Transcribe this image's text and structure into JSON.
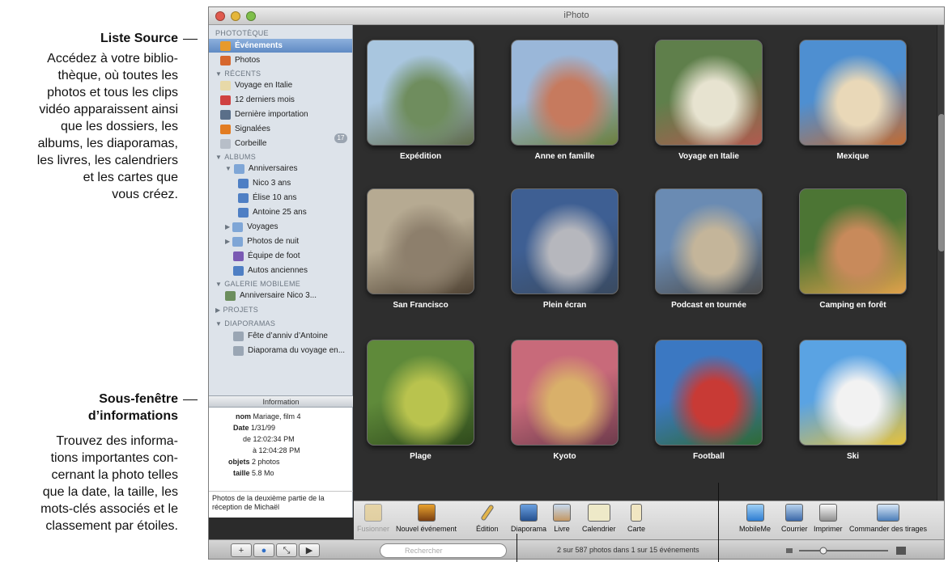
{
  "window": {
    "title": "iPhoto"
  },
  "callouts": {
    "source": {
      "title": "Liste Source",
      "lines": [
        "Accédez à votre biblio-",
        "thèque, où toutes les",
        "photos et tous les clips",
        "vidéo apparaissent ainsi",
        "que les dossiers, les",
        "albums, les diaporamas,",
        "les livres, les calendriers",
        "et les cartes que",
        "vous créez."
      ]
    },
    "info": {
      "title_lines": [
        "Sous-fenêtre",
        "d’informations"
      ],
      "lines": [
        "Trouvez des informa-",
        "tions importantes con-",
        "cernant la photo telles",
        "que la date, la taille, les",
        "mots-clés associés et le",
        "classement par étoiles."
      ]
    }
  },
  "sidebar": {
    "sections": {
      "library": "PHOTOTÈQUE",
      "recents": "RÉCENTS",
      "albums": "ALBUMS",
      "gallery": "GALERIE MOBILEME",
      "projects": "PROJETS",
      "slideshows": "DIAPORAMAS"
    },
    "items": {
      "events": "Événements",
      "photos": "Photos",
      "italy": "Voyage en Italie",
      "months": "12 derniers mois",
      "import": "Dernière importation",
      "flagged": "Signalées",
      "trash": "Corbeille",
      "birthdays": "Anniversaires",
      "nico": "Nico 3 ans",
      "elise": "Élise 10 ans",
      "antoine": "Antoine 25 ans",
      "voyages": "Voyages",
      "night": "Photos de nuit",
      "foot": "Équipe de foot",
      "autos": "Autos anciennes",
      "gallery_item": "Anniversaire Nico 3...",
      "fete": "Fête d’anniv d’Antoine",
      "diapo": "Diaporama du voyage en..."
    },
    "flagged_count": "17"
  },
  "info_pane": {
    "header": "Information",
    "name_label": "nom",
    "name_value": "Mariage, film 4",
    "date_label": "Date",
    "date_value": "1/31/99",
    "from_label": "de",
    "from_value": "12:02:34 PM",
    "to_label": "à",
    "to_value": "12:04:28 PM",
    "items_label": "objets",
    "items_value": "2 photos",
    "size_label": "taille",
    "size_value": "5.8 Mo",
    "comment": "Photos de la deuxième partie de la réception de Michaël"
  },
  "events": [
    {
      "label": "Expédition",
      "colors": [
        "#a9c6df",
        "#6f8d5e",
        "#5e6a49"
      ]
    },
    {
      "label": "Anne en famille",
      "colors": [
        "#9ab7d9",
        "#c67a5e",
        "#6b7f3d"
      ]
    },
    {
      "label": "Voyage en Italie",
      "colors": [
        "#5f7f4b",
        "#e7e3d0",
        "#b05a4f"
      ]
    },
    {
      "label": "Mexique",
      "colors": [
        "#4e8fd1",
        "#e9d8b8",
        "#c06b33"
      ]
    },
    {
      "label": "San Francisco",
      "colors": [
        "#b6aa92",
        "#8d7f6c",
        "#4f4233"
      ]
    },
    {
      "label": "Plein écran",
      "colors": [
        "#3e5f93",
        "#b6b7bd",
        "#3a4a60"
      ]
    },
    {
      "label": "Podcast en tournée",
      "colors": [
        "#6a8bb3",
        "#c4b59a",
        "#4b4b4b"
      ]
    },
    {
      "label": "Camping en forêt",
      "colors": [
        "#4c7534",
        "#c88a5b",
        "#e0a14b"
      ]
    },
    {
      "label": "Plage",
      "colors": [
        "#5f8a3a",
        "#b9c34e",
        "#2f4a1c"
      ]
    },
    {
      "label": "Kyoto",
      "colors": [
        "#c86a7a",
        "#d9b06a",
        "#6e3b4c"
      ]
    },
    {
      "label": "Football",
      "colors": [
        "#3b78c2",
        "#c83a35",
        "#2f6a35"
      ]
    },
    {
      "label": "Ski",
      "colors": [
        "#5aa3e3",
        "#f2f2f2",
        "#e5c13b"
      ]
    }
  ],
  "toolbar": {
    "merge": "Fusionner",
    "new_event": "Nouvel événement",
    "edit": "Édition",
    "slideshow": "Diaporama",
    "book": "Livre",
    "calendar": "Calendrier",
    "card": "Carte",
    "mobileme": "MobileMe",
    "mail": "Courrier",
    "print": "Imprimer",
    "order": "Commander des tirages"
  },
  "bottom": {
    "search_placeholder": "Rechercher",
    "status": "2 sur 587 photos dans 1 sur 15 événements"
  },
  "colors": {
    "accent": "#5f8ac4",
    "dark_bg": "#2e2e2e"
  }
}
